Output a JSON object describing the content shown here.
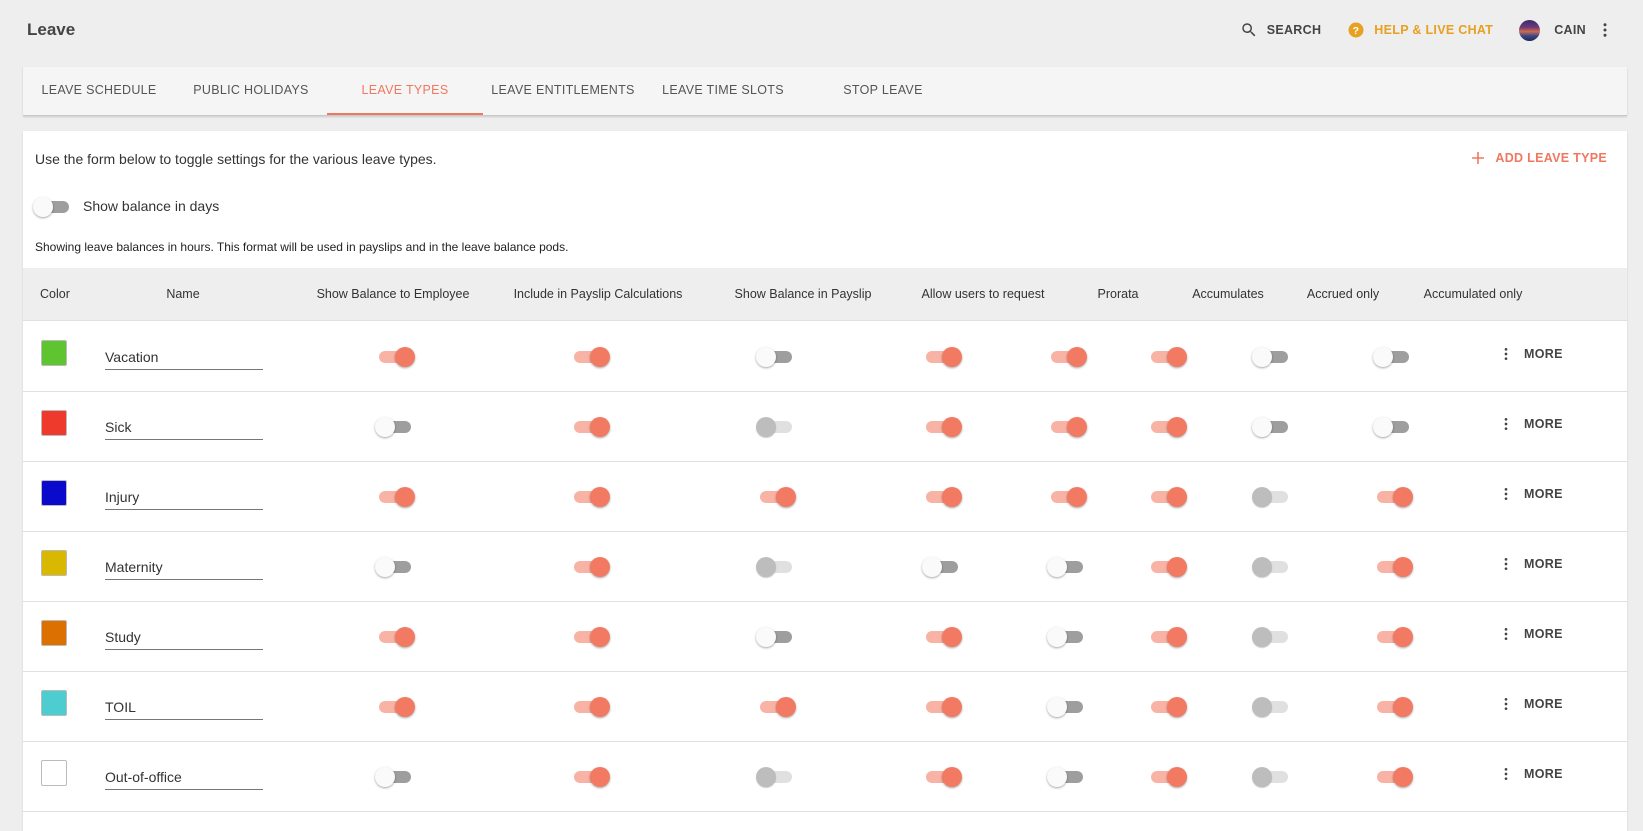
{
  "app": {
    "title": "Leave"
  },
  "top_actions": {
    "search": "SEARCH",
    "help": "HELP & LIVE CHAT",
    "user": "CAIN"
  },
  "tabs": [
    {
      "label": "LEAVE SCHEDULE",
      "active": false
    },
    {
      "label": "PUBLIC HOLIDAYS",
      "active": false
    },
    {
      "label": "LEAVE TYPES",
      "active": true
    },
    {
      "label": "LEAVE ENTITLEMENTS",
      "active": false
    },
    {
      "label": "LEAVE TIME SLOTS",
      "active": false
    },
    {
      "label": "STOP LEAVE",
      "active": false
    }
  ],
  "content": {
    "intro": "Use the form below to toggle settings for the various leave types.",
    "add_button": "ADD LEAVE TYPE",
    "show_balance_label": "Show balance in days",
    "show_balance_on": false,
    "note": "Showing leave balances in hours. This format will be used in payslips and in the leave balance pods."
  },
  "table": {
    "headers": {
      "color": "Color",
      "name": "Name",
      "show_balance_employee": "Show Balance to Employee",
      "include_payslip_calc": "Include in Payslip Calculations",
      "show_balance_payslip": "Show Balance in Payslip",
      "allow_request": "Allow users to request",
      "prorata": "Prorata",
      "accumulates": "Accumulates",
      "accrued_only": "Accrued only",
      "accumulated_only": "Accumulated only"
    },
    "more_label": "MORE",
    "rows": [
      {
        "color": "#5ec530",
        "name": "Vacation",
        "toggles": [
          "on",
          "on",
          "off",
          "on",
          "on",
          "on",
          "off",
          "off"
        ]
      },
      {
        "color": "#ee3a2d",
        "name": "Sick",
        "toggles": [
          "off",
          "on",
          "dis",
          "on",
          "on",
          "on",
          "off",
          "off"
        ]
      },
      {
        "color": "#0a0acc",
        "name": "Injury",
        "toggles": [
          "on",
          "on",
          "on",
          "on",
          "on",
          "on",
          "dis",
          "on"
        ]
      },
      {
        "color": "#d8b800",
        "name": "Maternity",
        "toggles": [
          "off",
          "on",
          "dis",
          "off",
          "off",
          "on",
          "dis",
          "on"
        ]
      },
      {
        "color": "#dc7000",
        "name": "Study",
        "toggles": [
          "on",
          "on",
          "off",
          "on",
          "off",
          "on",
          "dis",
          "on"
        ]
      },
      {
        "color": "#4ecdd0",
        "name": "TOIL",
        "toggles": [
          "on",
          "on",
          "on",
          "on",
          "off",
          "on",
          "dis",
          "on"
        ]
      },
      {
        "color": "#ffffff",
        "name": "Out-of-office",
        "toggles": [
          "off",
          "on",
          "dis",
          "on",
          "off",
          "on",
          "dis",
          "on"
        ]
      }
    ]
  }
}
